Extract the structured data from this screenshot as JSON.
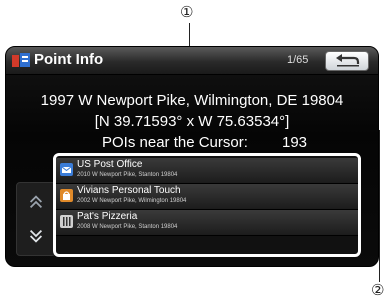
{
  "callouts": {
    "one": "①",
    "two": "②"
  },
  "header": {
    "title": "Point Info",
    "page": "1/65"
  },
  "location": {
    "address": "1997 W Newport Pike, Wilmington, DE 19804",
    "coordinates": "[N 39.71593° x W 75.63534°]",
    "poi_label": "POIs near the Cursor:",
    "poi_count": "193"
  },
  "pois": [
    {
      "name": "US Post Office",
      "address": "2010 W Newport Pike, Stanton 19804",
      "icon": "mail-icon"
    },
    {
      "name": "Vivians Personal Touch",
      "address": "2002 W Newport Pike, Wilmington 19804",
      "icon": "shop-icon"
    },
    {
      "name": "Pat's Pizzeria",
      "address": "2008 W Newport Pike, Stanton 19804",
      "icon": "restaurant-icon"
    }
  ],
  "colors": {
    "screen_bg": "#0b0b0b",
    "titlebar": "#3a3a3a",
    "highlight": "#ffffff"
  }
}
